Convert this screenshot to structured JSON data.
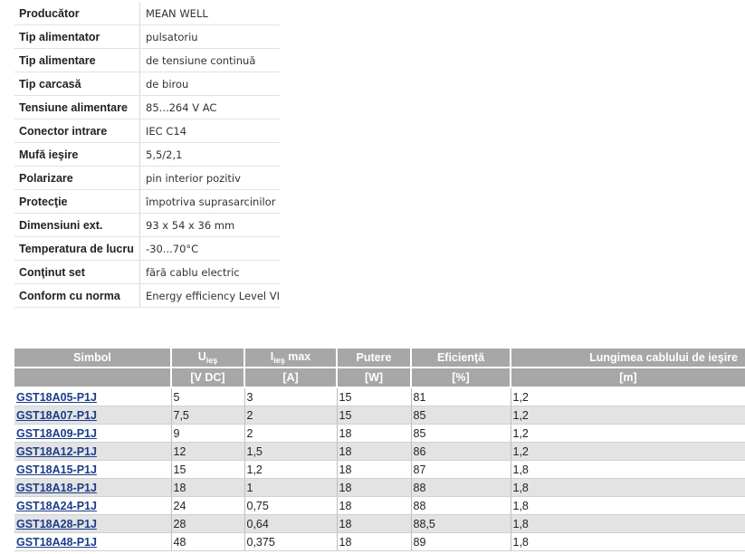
{
  "specs": [
    {
      "label": "Producător",
      "value": "MEAN WELL"
    },
    {
      "label": "Tip alimentator",
      "value": "pulsatoriu"
    },
    {
      "label": "Tip alimentare",
      "value": "de tensiune continuă"
    },
    {
      "label": "Tip carcasă",
      "value": "de birou"
    },
    {
      "label": "Tensiune alimentare",
      "value": "85...264 V AC"
    },
    {
      "label": "Conector intrare",
      "value": "IEC C14"
    },
    {
      "label": "Mufă ieşire",
      "value": "5,5/2,1"
    },
    {
      "label": "Polarizare",
      "value": "pin interior pozitiv"
    },
    {
      "label": "Protecţie",
      "value": "împotriva suprasarcinilor"
    },
    {
      "label": "Dimensiuni ext.",
      "value": "93 x 54 x 36 mm"
    },
    {
      "label": "Temperatura de lucru",
      "value": "-30...70°C"
    },
    {
      "label": "Conţinut set",
      "value": "fără cablu electric"
    },
    {
      "label": "Conform cu norma",
      "value": "Energy efficiency Level VI"
    }
  ],
  "models_table": {
    "headers": {
      "symbol": "Simbol",
      "voltage_main": "U",
      "voltage_sub": "ieş",
      "current_main": "I",
      "current_sub": "ieş",
      "current_suffix": " max",
      "power": "Putere",
      "efficiency": "Eficienţă",
      "cable": "Lungimea cablului de ieşire"
    },
    "units": {
      "symbol": "",
      "voltage": "[V DC]",
      "current": "[A]",
      "power": "[W]",
      "efficiency": "[%]",
      "cable": "[m]"
    },
    "rows": [
      {
        "symbol": "GST18A05-P1J",
        "voltage": "5",
        "current": "3",
        "power": "15",
        "efficiency": "81",
        "cable": "1,2"
      },
      {
        "symbol": "GST18A07-P1J",
        "voltage": "7,5",
        "current": "2",
        "power": "15",
        "efficiency": "85",
        "cable": "1,2"
      },
      {
        "symbol": "GST18A09-P1J",
        "voltage": "9",
        "current": "2",
        "power": "18",
        "efficiency": "85",
        "cable": "1,2"
      },
      {
        "symbol": "GST18A12-P1J",
        "voltage": "12",
        "current": "1,5",
        "power": "18",
        "efficiency": "86",
        "cable": "1,2"
      },
      {
        "symbol": "GST18A15-P1J",
        "voltage": "15",
        "current": "1,2",
        "power": "18",
        "efficiency": "87",
        "cable": "1,8"
      },
      {
        "symbol": "GST18A18-P1J",
        "voltage": "18",
        "current": "1",
        "power": "18",
        "efficiency": "88",
        "cable": "1,8"
      },
      {
        "symbol": "GST18A24-P1J",
        "voltage": "24",
        "current": "0,75",
        "power": "18",
        "efficiency": "88",
        "cable": "1,8"
      },
      {
        "symbol": "GST18A28-P1J",
        "voltage": "28",
        "current": "0,64",
        "power": "18",
        "efficiency": "88,5",
        "cable": "1,8"
      },
      {
        "symbol": "GST18A48-P1J",
        "voltage": "48",
        "current": "0,375",
        "power": "18",
        "efficiency": "89",
        "cable": "1,8"
      }
    ]
  },
  "colors": {
    "header_bg": "#a7a7a7",
    "alt_row_bg": "#e3e3e3",
    "link": "#1a3c8a"
  }
}
